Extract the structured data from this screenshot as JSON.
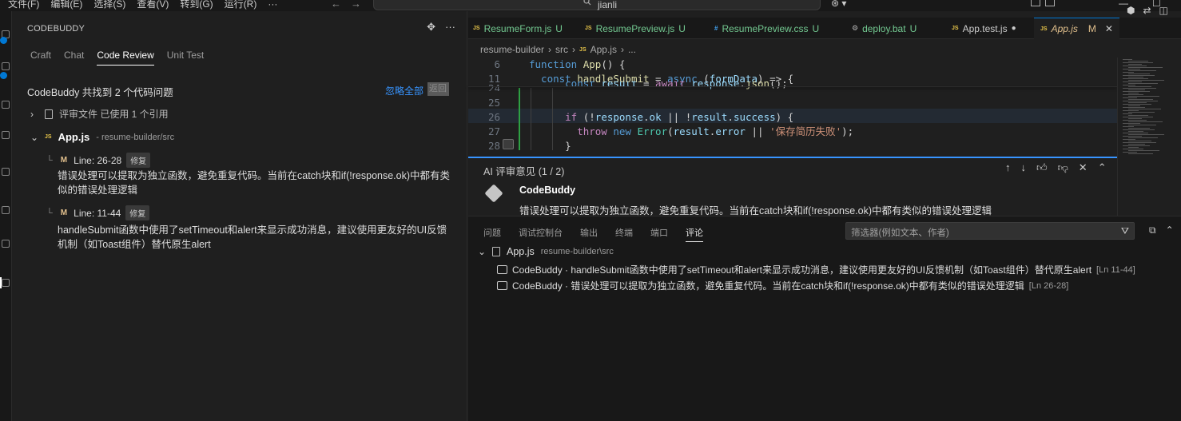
{
  "menu": [
    "文件(F)",
    "编辑(E)",
    "选择(S)",
    "查看(V)",
    "转到(G)",
    "运行(R)",
    "···"
  ],
  "command_center": {
    "text": "jianli"
  },
  "window": {
    "copilot": "⊛ ▾"
  },
  "left_panel": {
    "header": "CODEBUDDY",
    "tabs": [
      "Craft",
      "Chat",
      "Code Review",
      "Unit Test"
    ],
    "active_tab": "Code Review",
    "summary": "CodeBuddy 共找到 2 个代码问题",
    "ignore_all": "忽略全部",
    "ignore_box": "返回",
    "refs": "评审文件 已使用 1 个引用",
    "file": {
      "name": "App.js",
      "path": "- resume-builder/src",
      "icon": "JS"
    },
    "issues": [
      {
        "badge": "M",
        "line": "Line: 26-28",
        "fix": "修复",
        "text": "错误处理可以提取为独立函数，避免重复代码。当前在catch块和if(!response.ok)中都有类似的错误处理逻辑"
      },
      {
        "badge": "M",
        "line": "Line: 11-44",
        "fix": "修复",
        "text": "handleSubmit函数中使用了setTimeout和alert来显示成功消息，建议使用更友好的UI反馈机制（如Toast组件）替代原生alert"
      }
    ]
  },
  "editor": {
    "tabs": [
      {
        "name": "ResumeForm.js",
        "mark": "U",
        "type": "js"
      },
      {
        "name": "ResumePreview.js",
        "mark": "U",
        "type": "js"
      },
      {
        "name": "ResumePreview.css",
        "mark": "U",
        "type": "css"
      },
      {
        "name": "deploy.bat",
        "mark": "U",
        "type": "bat"
      },
      {
        "name": "App.test.js",
        "mark": "●",
        "type": "js"
      },
      {
        "name": "App.js",
        "mark": "M",
        "type": "js"
      }
    ],
    "breadcrumb": [
      "resume-builder",
      "src",
      "App.js",
      "..."
    ],
    "lines": [
      {
        "num": "6",
        "tokens": [
          [
            "kw",
            "function "
          ],
          [
            "fn",
            "App"
          ],
          [
            "pun",
            "() {"
          ]
        ]
      },
      {
        "num": "11",
        "tokens": [
          [
            "kw",
            "  const "
          ],
          [
            "fn",
            "handleSubmit"
          ],
          [
            "pun",
            " = "
          ],
          [
            "kw",
            "async "
          ],
          [
            "pun",
            "("
          ],
          [
            "var",
            "formData"
          ],
          [
            "pun",
            ") => {"
          ]
        ]
      },
      {
        "num": "24",
        "tokens": [
          [
            "kw",
            "      const "
          ],
          [
            "var",
            "result"
          ],
          [
            "pun",
            " = "
          ],
          [
            "kw2",
            "await "
          ],
          [
            "var",
            "response"
          ],
          [
            "pun",
            "."
          ],
          [
            "fn",
            "json"
          ],
          [
            "pun",
            "();"
          ]
        ]
      },
      {
        "num": "25",
        "tokens": []
      },
      {
        "num": "26",
        "tokens": [
          [
            "kw2",
            "      if "
          ],
          [
            "pun",
            "(!"
          ],
          [
            "var",
            "response"
          ],
          [
            "pun",
            "."
          ],
          [
            "var",
            "ok"
          ],
          [
            "pun",
            " || !"
          ],
          [
            "var",
            "result"
          ],
          [
            "pun",
            "."
          ],
          [
            "var",
            "success"
          ],
          [
            "pun",
            ") {"
          ]
        ]
      },
      {
        "num": "27",
        "tokens": [
          [
            "kw2",
            "        throw "
          ],
          [
            "kw",
            "new "
          ],
          [
            "cls",
            "Error"
          ],
          [
            "pun",
            "("
          ],
          [
            "var",
            "result"
          ],
          [
            "pun",
            "."
          ],
          [
            "var",
            "error"
          ],
          [
            "pun",
            " || "
          ],
          [
            "str",
            "'保存简历失败'"
          ],
          [
            "pun",
            ");"
          ]
        ]
      },
      {
        "num": "28",
        "tokens": [
          [
            "pun",
            "      }"
          ]
        ]
      }
    ]
  },
  "ai_review": {
    "title": "AI 评审意见 (1 / 2)",
    "author": "CodeBuddy",
    "body": "错误处理可以提取为独立函数，避免重复代码。当前在catch块和if(!response.ok)中都有类似的错误处理逻辑"
  },
  "bottom_panel": {
    "tabs": [
      "问题",
      "调试控制台",
      "输出",
      "终端",
      "端口",
      "评论"
    ],
    "active_tab": "评论",
    "filter_placeholder": "筛选器(例如文本、作者)",
    "file": "App.js",
    "file_path": "resume-builder\\src",
    "comments": [
      {
        "text": "CodeBuddy · handleSubmit函数中使用了setTimeout和alert来显示成功消息，建议使用更友好的UI反馈机制（如Toast组件）替代原生alert",
        "ref": "[Ln 11-44]"
      },
      {
        "text": "CodeBuddy · 错误处理可以提取为独立函数，避免重复代码。当前在catch块和if(!response.ok)中都有类似的错误处理逻辑",
        "ref": "[Ln 26-28]"
      }
    ]
  }
}
